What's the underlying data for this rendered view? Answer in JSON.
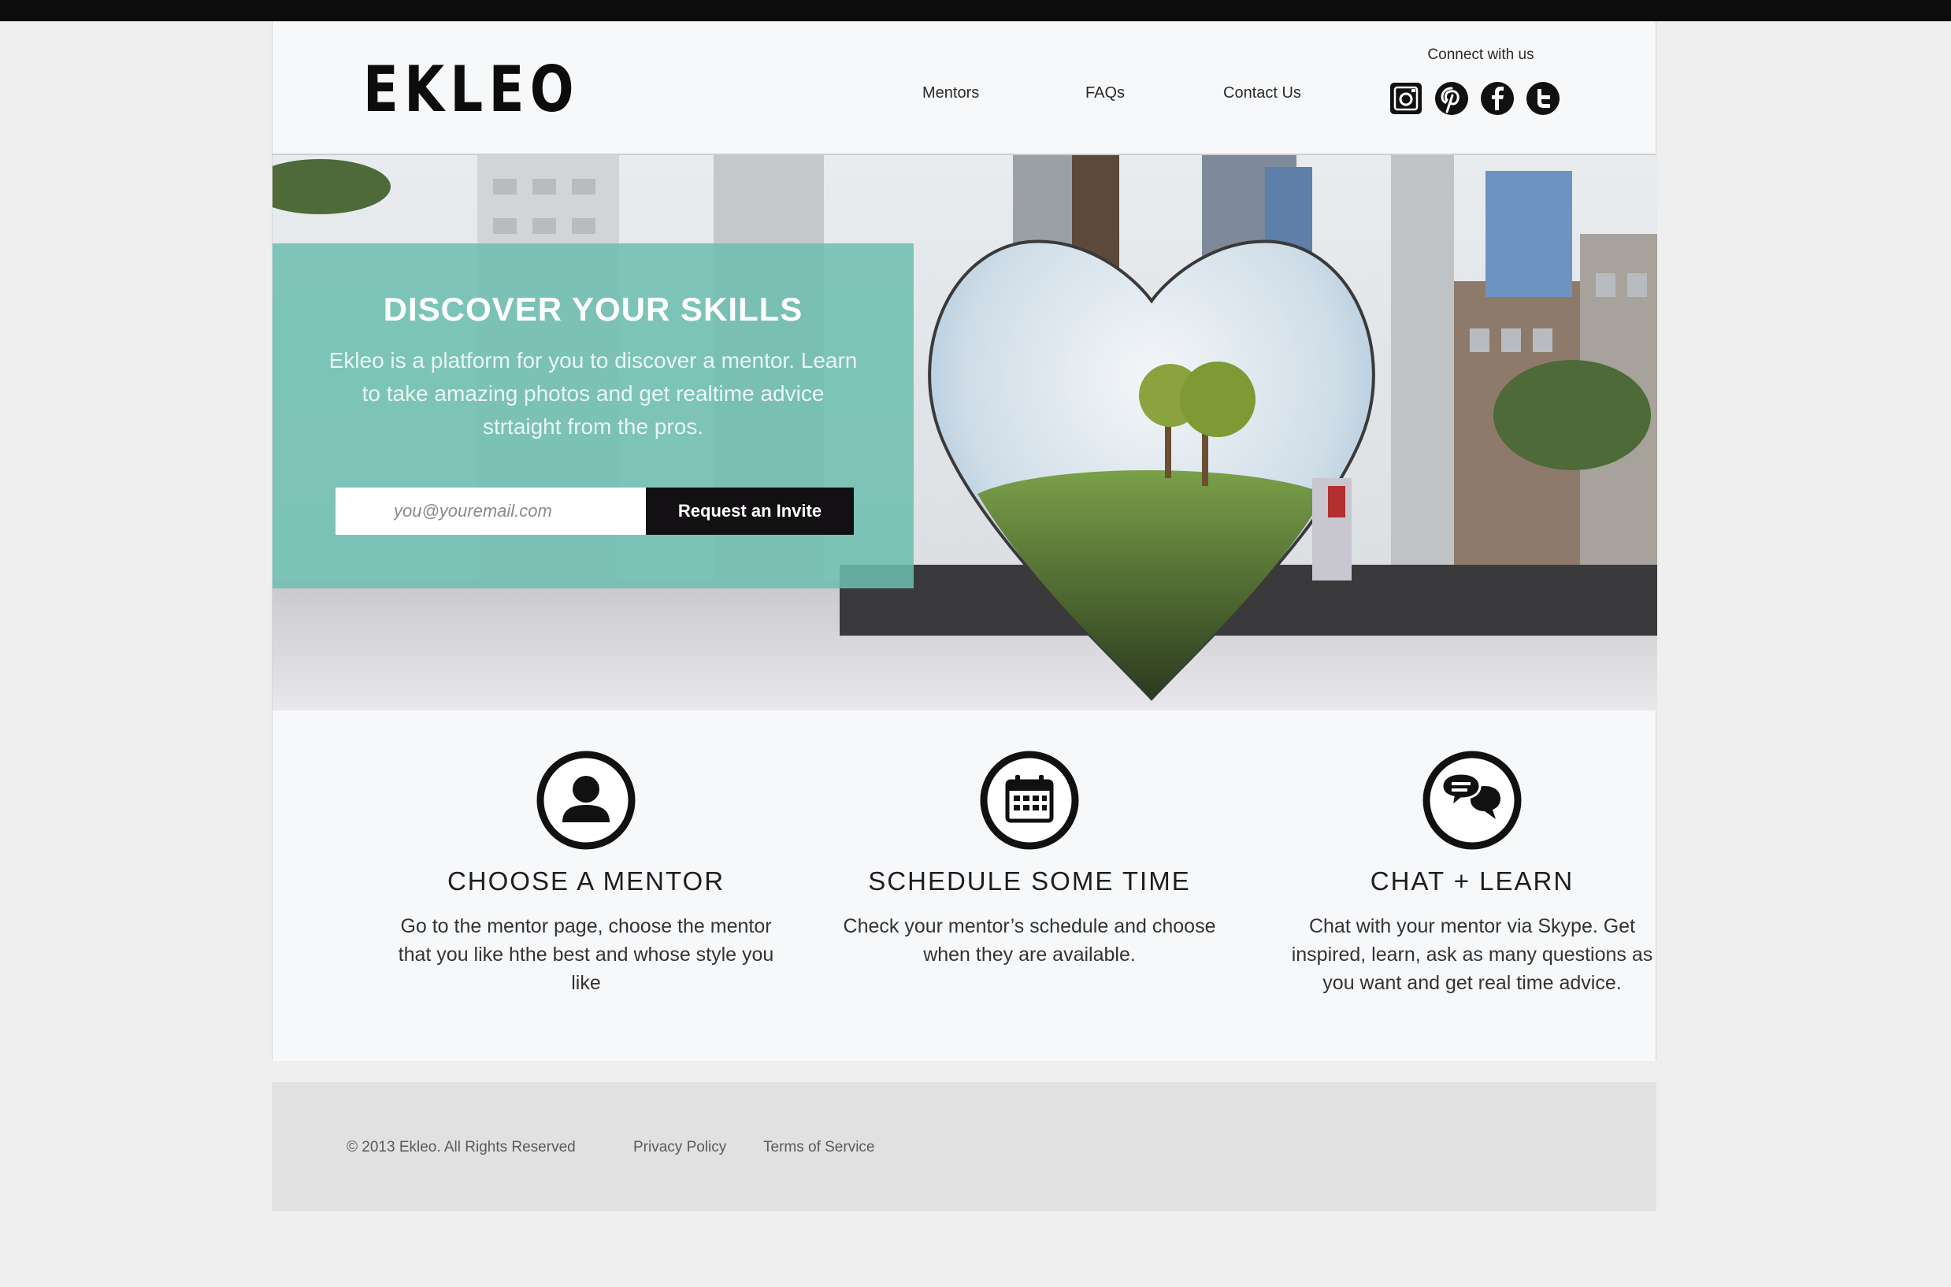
{
  "header": {
    "logo": "EKLEO",
    "nav": [
      "Mentors",
      "FAQs",
      "Contact Us"
    ],
    "connect_label": "Connect with us",
    "social_icons": [
      "instagram-icon",
      "pinterest-icon",
      "facebook-icon",
      "twitter-icon"
    ]
  },
  "hero": {
    "title": "DISCOVER YOUR SKILLS",
    "text": "Ekleo is a platform for you to discover a mentor. Learn to take amazing photos and get realtime advice strtaight from the pros.",
    "email_placeholder": "you@youremail.com",
    "button_label": "Request an Invite",
    "card_color": "#6cbeb0"
  },
  "features": [
    {
      "icon": "user-icon",
      "title": "CHOOSE A MENTOR",
      "text": "Go to the mentor page, choose the mentor that you like hthe best and whose style you like"
    },
    {
      "icon": "calendar-icon",
      "title": "SCHEDULE SOME TIME",
      "text": "Check your mentor’s schedule and choose when they are available."
    },
    {
      "icon": "chat-icon",
      "title": "CHAT + LEARN",
      "text": "Chat with your mentor via Skype. Get inspired, learn, ask as many questions as you want and get real time advice."
    }
  ],
  "footer": {
    "copyright": "© 2013 Ekleo. All Rights Reserved",
    "privacy": "Privacy Policy",
    "terms": "Terms of Service"
  }
}
